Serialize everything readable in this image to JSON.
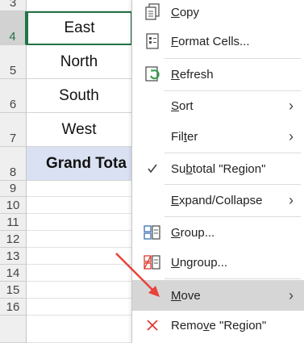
{
  "rows": [
    {
      "num": "3",
      "value": ""
    },
    {
      "num": "4",
      "value": "East"
    },
    {
      "num": "5",
      "value": "North"
    },
    {
      "num": "6",
      "value": "South"
    },
    {
      "num": "7",
      "value": "West"
    },
    {
      "num": "8",
      "value": "Grand Tota"
    },
    {
      "num": "9",
      "value": ""
    },
    {
      "num": "10",
      "value": ""
    },
    {
      "num": "11",
      "value": ""
    },
    {
      "num": "12",
      "value": ""
    },
    {
      "num": "13",
      "value": ""
    },
    {
      "num": "14",
      "value": ""
    },
    {
      "num": "15",
      "value": ""
    },
    {
      "num": "16",
      "value": ""
    }
  ],
  "menu": {
    "copy": {
      "pre": "",
      "u": "C",
      "post": "opy",
      "icon": "copy-icon"
    },
    "format": {
      "pre": "",
      "u": "F",
      "post": "ormat Cells...",
      "icon": "format-cells-icon"
    },
    "refresh": {
      "pre": "",
      "u": "R",
      "post": "efresh",
      "icon": "refresh-icon"
    },
    "sort": {
      "pre": "",
      "u": "S",
      "post": "ort"
    },
    "filter": {
      "pre": "Fil",
      "u": "t",
      "post": "er"
    },
    "subtotal": {
      "pre": "Su",
      "u": "b",
      "post": "total \"Region\"",
      "icon": "checkmark-icon"
    },
    "expand": {
      "pre": "",
      "u": "E",
      "post": "xpand/Collapse"
    },
    "group": {
      "pre": "",
      "u": "G",
      "post": "roup...",
      "icon": "group-icon"
    },
    "ungroup": {
      "pre": "",
      "u": "U",
      "post": "ngroup...",
      "icon": "ungroup-icon"
    },
    "move": {
      "pre": "",
      "u": "M",
      "post": "ove"
    },
    "remove": {
      "pre": "Remo",
      "u": "v",
      "post": "e \"Region\"",
      "icon": "remove-x-icon"
    }
  },
  "chevron": "›",
  "colors": {
    "accent_green": "#217346",
    "total_fill": "#d9e1f2",
    "arrow_red": "#e8423a",
    "remove_red": "#e0312a"
  }
}
